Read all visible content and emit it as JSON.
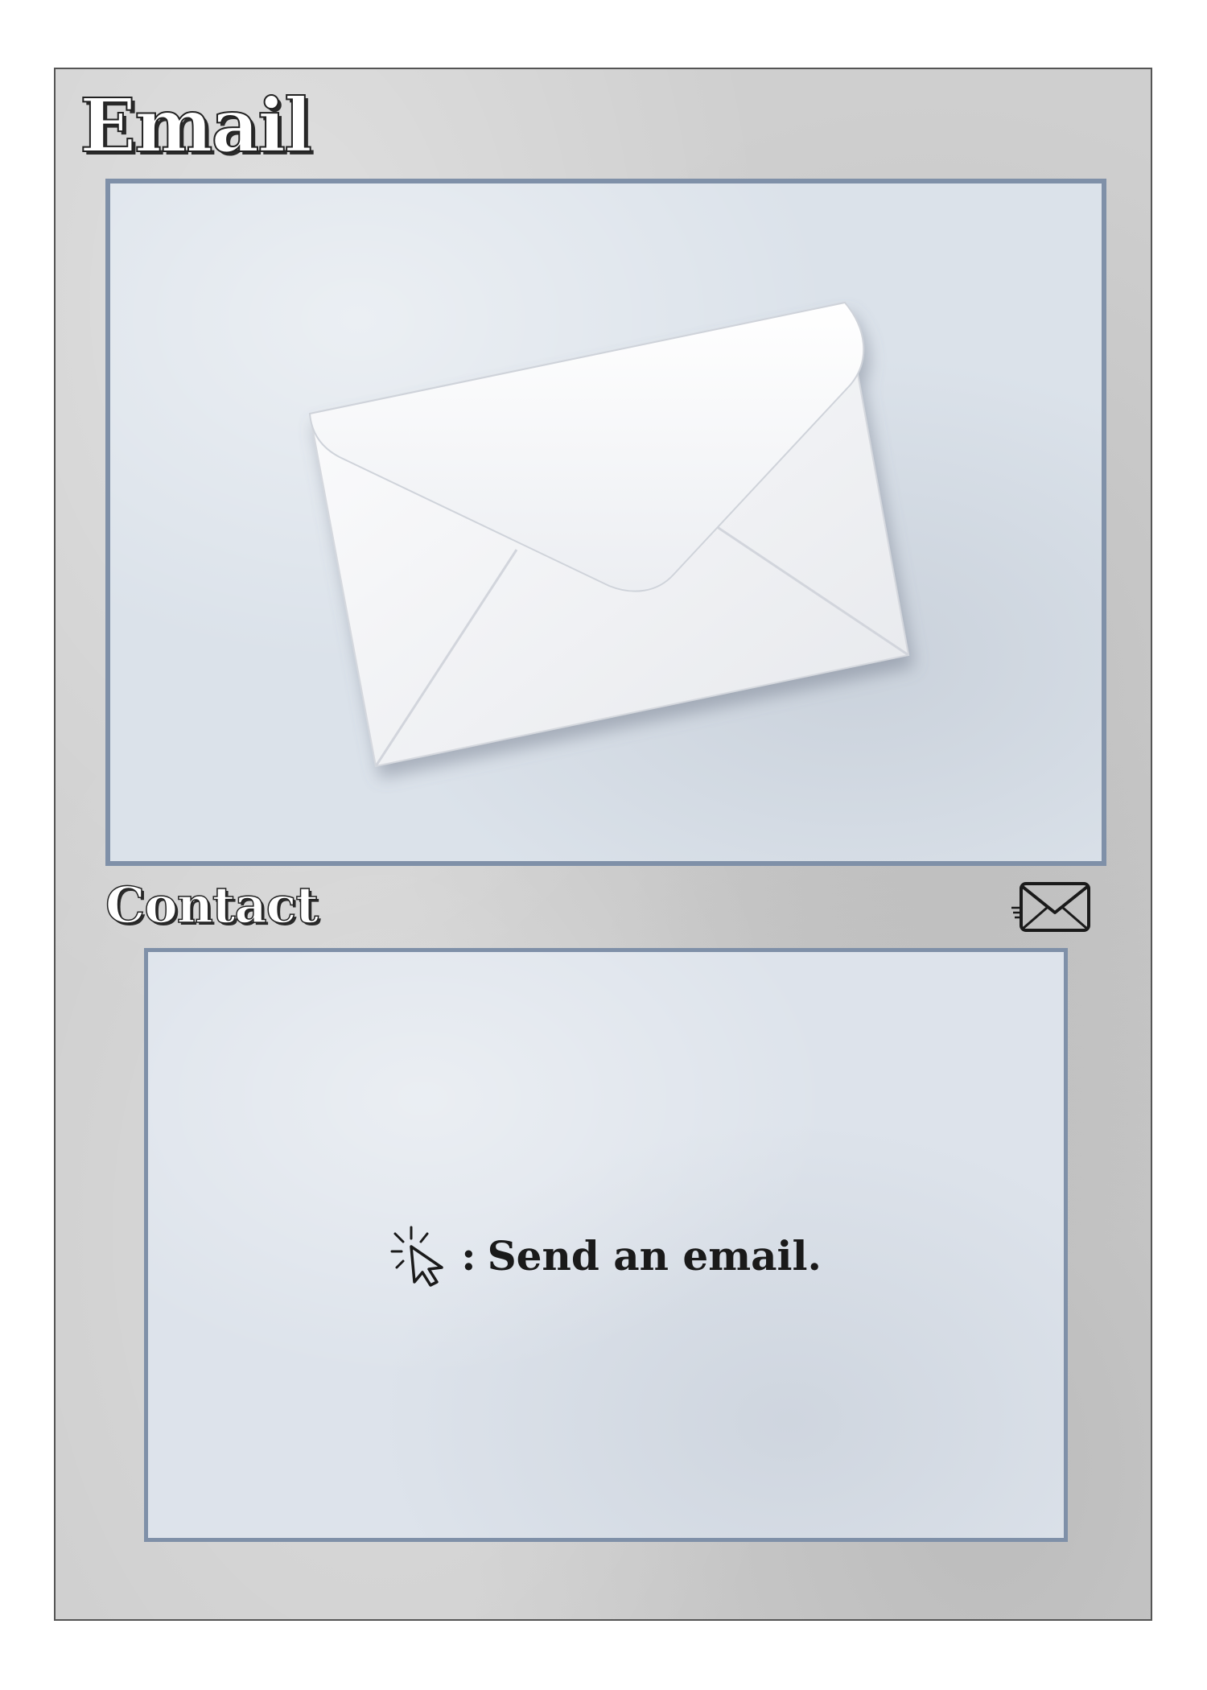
{
  "card": {
    "title": "Email",
    "art_icon": "envelope-icon",
    "type_label": "Contact",
    "type_icon": "envelope-icon",
    "ability": {
      "trigger_icon": "click-cursor-icon",
      "separator": ":",
      "text": "Send an email."
    }
  },
  "colors": {
    "card_background": "#cfcfcf",
    "frame_border": "#7f90a8",
    "frame_fill": "#dbe2ea",
    "text": "#1a1a1a"
  }
}
